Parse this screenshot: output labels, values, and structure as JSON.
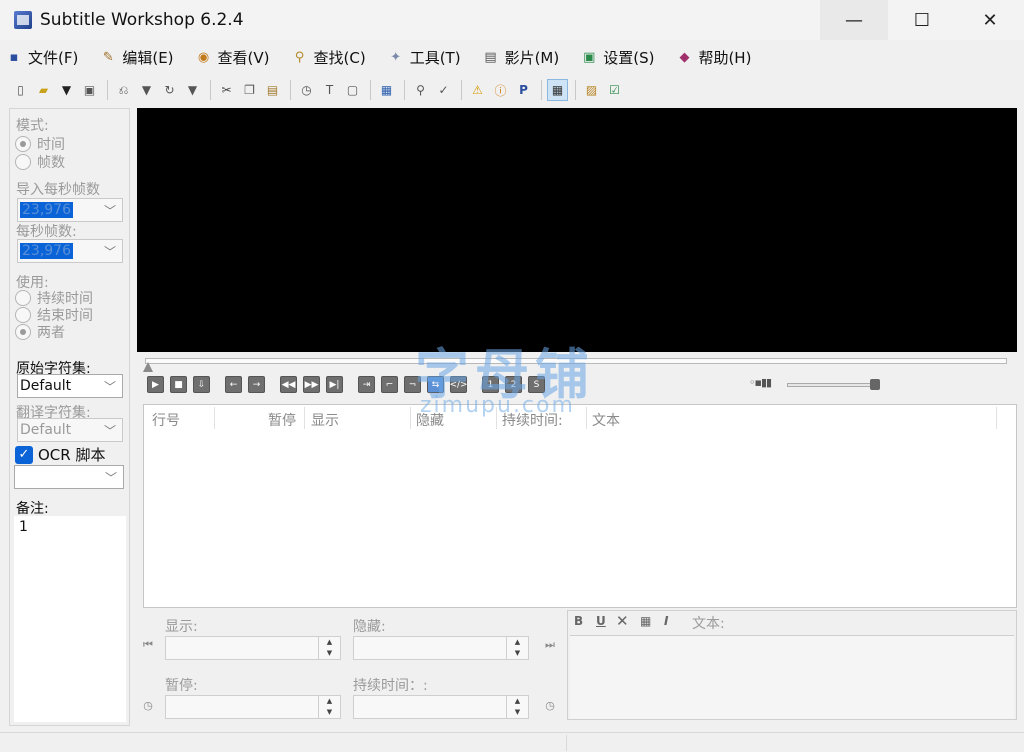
{
  "window": {
    "title": "Subtitle Workshop 6.2.4",
    "minimize": "—",
    "maximize": "☐",
    "close": "✕"
  },
  "menu": [
    {
      "label": "文件(F)",
      "icon": "save-icon",
      "glyph": "▪",
      "color": "#2b4f9e"
    },
    {
      "label": "编辑(E)",
      "icon": "edit-icon",
      "glyph": "✎",
      "color": "#a0702a"
    },
    {
      "label": "查看(V)",
      "icon": "eye-icon",
      "glyph": "◉",
      "color": "#c27a1a"
    },
    {
      "label": "查找(C)",
      "icon": "search-icon",
      "glyph": "⚲",
      "color": "#b58a2a"
    },
    {
      "label": "工具(T)",
      "icon": "wrench-icon",
      "glyph": "✦",
      "color": "#7a8aa8"
    },
    {
      "label": "影片(M)",
      "icon": "clapper-icon",
      "glyph": "▤",
      "color": "#555"
    },
    {
      "label": "设置(S)",
      "icon": "settings-icon",
      "glyph": "▣",
      "color": "#2a8a4a"
    },
    {
      "label": "帮助(H)",
      "icon": "help-book-icon",
      "glyph": "◆",
      "color": "#a0306a"
    }
  ],
  "left": {
    "mode_label": "模式:",
    "mode_time": "时间",
    "mode_frames": "帧数",
    "input_fps_label": "导入每秒帧数",
    "input_fps_value": "23,976",
    "fps_label": "每秒帧数:",
    "fps_value": "23,976",
    "use_label": "使用:",
    "use_duration": "持续时间",
    "use_end": "结束时间",
    "use_both": "两者",
    "orig_charset_label": "原始字符集:",
    "orig_charset_value": "Default",
    "trans_charset_label": "翻译字符集:",
    "trans_charset_value": "Default",
    "ocr_label": "OCR 脚本",
    "notes_label": "备注:",
    "notes_value": "1"
  },
  "columns": {
    "num": "行号",
    "pause": "暂停",
    "show": "显示",
    "hide": "隐藏",
    "duration": "持续时间:",
    "text": "文本"
  },
  "edit": {
    "show_label": "显示:",
    "hide_label": "隐藏:",
    "pause_label": "暂停:",
    "duration_label": "持续时间：:",
    "text_label": "文本:"
  },
  "watermark": {
    "line1": "字母铺",
    "line2": "zimupu.com"
  },
  "volume_icon": "◦▪▮▮"
}
